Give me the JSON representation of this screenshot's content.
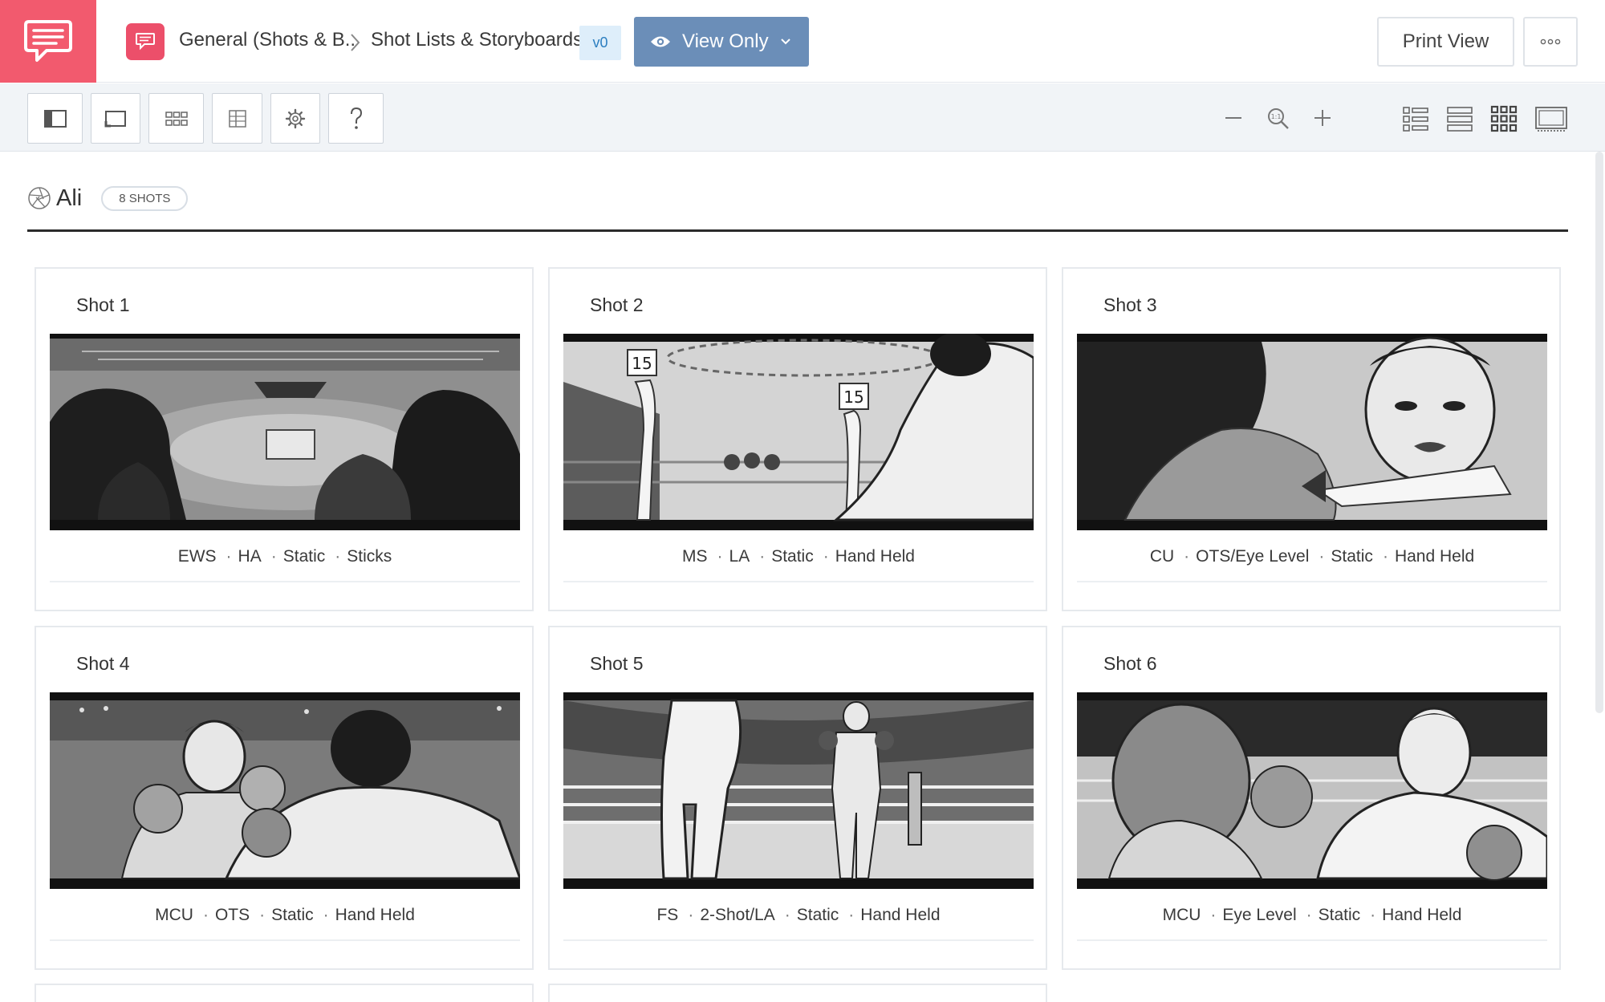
{
  "header": {
    "breadcrumb_project": "General (Shots & B..",
    "breadcrumb_page": "Shot Lists & Storyboards",
    "version": "v0",
    "view_mode": "View Only",
    "print_label": "Print View"
  },
  "scene": {
    "title": "Ali",
    "shot_count": "8 SHOTS"
  },
  "shots": [
    {
      "title": "Shot 1",
      "tags": [
        "EWS",
        "HA",
        "Static",
        "Sticks"
      ]
    },
    {
      "title": "Shot 2",
      "tags": [
        "MS",
        "LA",
        "Static",
        "Hand Held"
      ],
      "sign_numbers": [
        "15",
        "15"
      ]
    },
    {
      "title": "Shot 3",
      "tags": [
        "CU",
        "OTS/Eye Level",
        "Static",
        "Hand Held"
      ]
    },
    {
      "title": "Shot 4",
      "tags": [
        "MCU",
        "OTS",
        "Static",
        "Hand Held"
      ]
    },
    {
      "title": "Shot 5",
      "tags": [
        "FS",
        "2-Shot/LA",
        "Static",
        "Hand Held"
      ]
    },
    {
      "title": "Shot 6",
      "tags": [
        "MCU",
        "Eye Level",
        "Static",
        "Hand Held"
      ]
    }
  ],
  "icons": {
    "brand": "chat-bubble-icon",
    "project": "chat-bubble-icon",
    "view": "eye-icon",
    "toolbar": [
      "sidebar-icon",
      "frame-icon",
      "grid-icon",
      "split-icon",
      "gear-icon",
      "help-icon"
    ],
    "zoom": [
      "zoom-out-icon",
      "zoom-reset-icon",
      "zoom-in-icon"
    ],
    "views": [
      "list-view-icon",
      "row-view-icon",
      "grid-view-icon",
      "presentation-view-icon"
    ]
  },
  "colors": {
    "brand": "#f25a6e",
    "view_button": "#6b8eb8",
    "version_badge": "#deeefa"
  }
}
